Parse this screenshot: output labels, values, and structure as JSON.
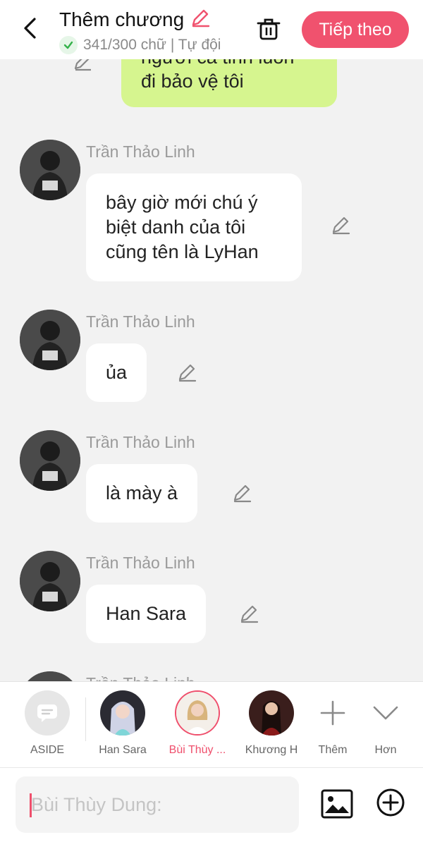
{
  "header": {
    "title": "Thêm chương",
    "subtitle": "341/300 chữ | Tự đội",
    "next_label": "Tiếp theo",
    "accent": "#f0526e"
  },
  "my_message": {
    "line_partial": "người cả tỉnh luôn",
    "line_visible": "đi bảo vệ tôi"
  },
  "messages": [
    {
      "sender": "Trần Thảo Linh",
      "text": "bây giờ mới chú ý biệt danh của tôi cũng tên là LyHan"
    },
    {
      "sender": "Trần Thảo Linh",
      "text": "ủa"
    },
    {
      "sender": "Trần Thảo Linh",
      "text": "là mày à"
    },
    {
      "sender": "Trần Thảo Linh",
      "text": "Han Sara"
    },
    {
      "sender": "Trần Thảo Linh",
      "text": ""
    }
  ],
  "characters": [
    {
      "name": "ASIDE",
      "icon": "chat-bubble-icon"
    },
    {
      "name": "Han Sara",
      "icon": "avatar"
    },
    {
      "name": "Bùi Thùy ...",
      "icon": "avatar",
      "selected": true
    },
    {
      "name": "Khương H",
      "icon": "avatar"
    },
    {
      "name": "Thêm",
      "icon": "plus-icon"
    },
    {
      "name": "Hơn",
      "icon": "chevron-down-icon"
    }
  ],
  "input": {
    "placeholder": "Bùi Thùy Dung:",
    "value": ""
  },
  "colors": {
    "my_bubble": "#d6f58f",
    "active_character": "#ef4f6c"
  }
}
